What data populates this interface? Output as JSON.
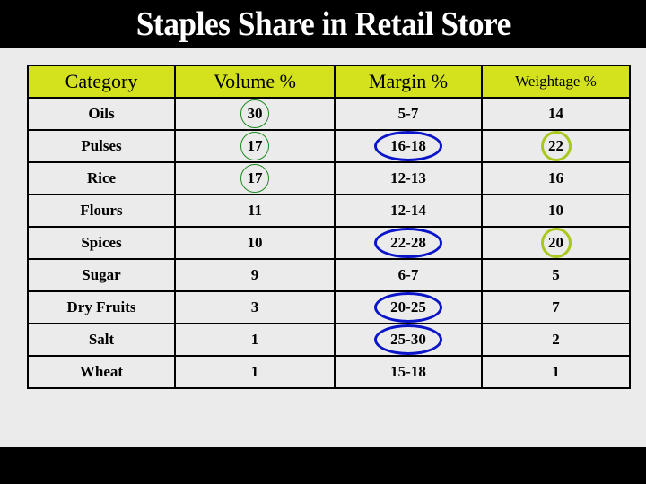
{
  "title": "Staples Share in Retail Store",
  "table": {
    "headers": {
      "category": "Category",
      "volume": "Volume %",
      "margin": "Margin %",
      "weightage": "Weightage %"
    },
    "rows": [
      {
        "category": "Oils",
        "volume": "30",
        "margin": "5-7",
        "weightage": "14"
      },
      {
        "category": "Pulses",
        "volume": "17",
        "margin": "16-18",
        "weightage": "22"
      },
      {
        "category": "Rice",
        "volume": "17",
        "margin": "12-13",
        "weightage": "16"
      },
      {
        "category": "Flours",
        "volume": "11",
        "margin": "12-14",
        "weightage": "10"
      },
      {
        "category": "Spices",
        "volume": "10",
        "margin": "22-28",
        "weightage": "20"
      },
      {
        "category": "Sugar",
        "volume": "9",
        "margin": "6-7",
        "weightage": "5"
      },
      {
        "category": "Dry Fruits",
        "volume": "3",
        "margin": "20-25",
        "weightage": "7"
      },
      {
        "category": "Salt",
        "volume": "1",
        "margin": "25-30",
        "weightage": "2"
      },
      {
        "category": "Wheat",
        "volume": "1",
        "margin": "15-18",
        "weightage": "1"
      }
    ],
    "highlights": {
      "volume_circled_green": [
        "Oils",
        "Pulses",
        "Rice"
      ],
      "margin_circled_blue": [
        "Pulses",
        "Spices",
        "Dry Fruits",
        "Salt"
      ],
      "weightage_circled_lime": [
        "Pulses",
        "Spices"
      ]
    },
    "colors": {
      "header_bg": "#d4e21e",
      "volume_mark": "#1e8a1e",
      "margin_mark": "#0a14c8",
      "weightage_mark": "#a8c81e"
    }
  }
}
